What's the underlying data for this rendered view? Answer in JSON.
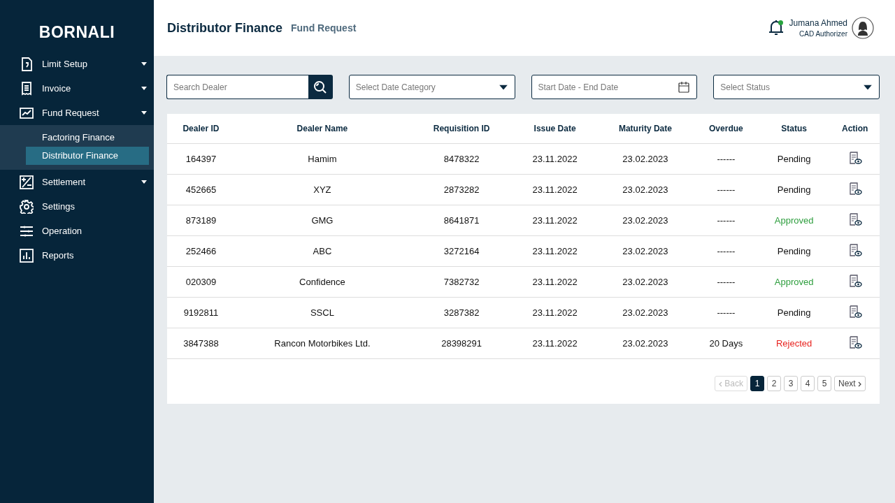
{
  "sidebar": {
    "brand": "BORNALI",
    "items": [
      {
        "label": "Limit Setup",
        "has_caret": true,
        "expanded": false
      },
      {
        "label": "Invoice",
        "has_caret": true,
        "expanded": false
      },
      {
        "label": "Fund Request",
        "has_caret": true,
        "expanded": true,
        "children": [
          {
            "label": "Factoring Finance",
            "selected": false
          },
          {
            "label": "Distributor Finance",
            "selected": true
          }
        ]
      },
      {
        "label": "Settlement",
        "has_caret": true,
        "expanded": false
      },
      {
        "label": "Settings",
        "has_caret": false,
        "expanded": false
      },
      {
        "label": "Operation",
        "has_caret": false,
        "expanded": false
      },
      {
        "label": "Reports",
        "has_caret": false,
        "expanded": false
      }
    ]
  },
  "header": {
    "title": "Distributor Finance",
    "subtitle": "Fund Request",
    "notification_unread": true,
    "user": {
      "name": "Jumana Ahmed",
      "role": "CAD Authorizer"
    }
  },
  "filters": [
    {
      "kind": "search",
      "placeholder": "Search Dealer"
    },
    {
      "kind": "select",
      "placeholder": "Select Date Category"
    },
    {
      "kind": "date",
      "placeholder": "Start Date - End Date"
    },
    {
      "kind": "select",
      "placeholder": "Select Status"
    }
  ],
  "table": {
    "columns": [
      "Dealer ID",
      "Dealer Name",
      "Requisition ID",
      "Issue Date",
      "Maturity Date",
      "Overdue",
      "Status",
      "Action"
    ],
    "rows": [
      {
        "cells": [
          "164397",
          "Hamim",
          "8478322",
          "23.11.2022",
          "23.02.2023",
          "------",
          "Pending"
        ],
        "color": "#111111"
      },
      {
        "cells": [
          "452665",
          "XYZ",
          "2873282",
          "23.11.2022",
          "23.02.2023",
          "------",
          "Pending"
        ],
        "color": "#111111"
      },
      {
        "cells": [
          "873189",
          "GMG",
          "8641871",
          "23.11.2022",
          "23.02.2023",
          "------",
          "Approved"
        ],
        "color": "#2e9e3e"
      },
      {
        "cells": [
          "252466",
          "ABC",
          "3272164",
          "23.11.2022",
          "23.02.2023",
          "------",
          "Pending"
        ],
        "color": "#111111"
      },
      {
        "cells": [
          "020309",
          "Confidence",
          "7382732",
          "23.11.2022",
          "23.02.2023",
          "------",
          "Approved"
        ],
        "color": "#2e9e3e"
      },
      {
        "cells": [
          "9192811",
          "SSCL",
          "3287382",
          "23.11.2022",
          "23.02.2023",
          "------",
          "Pending"
        ],
        "color": "#111111"
      },
      {
        "cells": [
          "3847388",
          "Rancon Motorbikes Ltd.",
          "28398291",
          "23.11.2022",
          "23.02.2023",
          "20 Days",
          "Rejected"
        ],
        "color": "#e8231f"
      }
    ]
  },
  "pagination": {
    "back": {
      "label": "Back",
      "disabled": true
    },
    "pages": [
      {
        "label": "1",
        "selected": true
      },
      {
        "label": "2",
        "selected": false
      },
      {
        "label": "3",
        "selected": false
      },
      {
        "label": "4",
        "selected": false
      },
      {
        "label": "5",
        "selected": false
      }
    ],
    "next": {
      "label": "Next",
      "disabled": false
    }
  }
}
